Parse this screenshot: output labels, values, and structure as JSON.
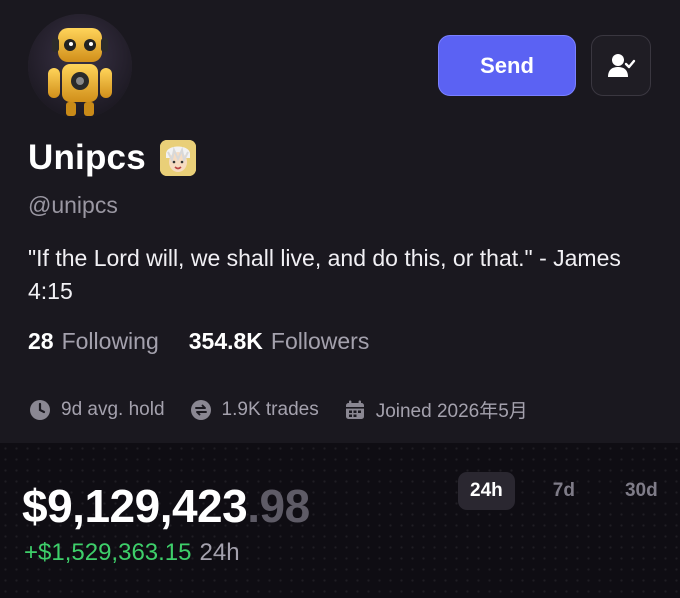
{
  "profile": {
    "name": "Unipcs",
    "handle": "@unipcs",
    "bio": "\"If the Lord will, we shall live, and do this, or that.\" - James 4:15",
    "avatar_icon": "robot-avatar",
    "badge_icon": "anime-character-badge"
  },
  "actions": {
    "send_label": "Send",
    "follow_icon": "user-check-icon",
    "accent_color": "#5b62f3"
  },
  "stats": {
    "following_count": "28",
    "following_label": "Following",
    "followers_count": "354.8K",
    "followers_label": "Followers"
  },
  "meta": {
    "avg_hold": "9d avg. hold",
    "trades": "1.9K trades",
    "joined": "Joined 2026年5月"
  },
  "balance": {
    "whole": "$9,129,423",
    "cents": ".98",
    "change": "+$1,529,363.15",
    "change_period": "24h",
    "change_color": "#3ecf6a"
  },
  "ranges": {
    "options": [
      "24h",
      "7d",
      "30d"
    ],
    "selected": "24h"
  }
}
